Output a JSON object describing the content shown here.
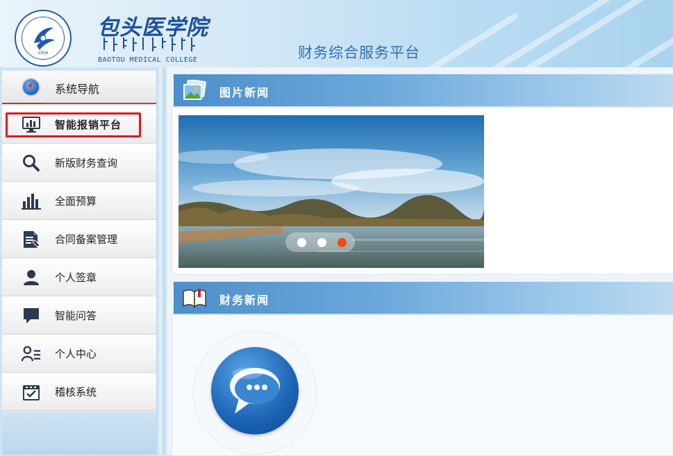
{
  "header": {
    "school_name": "包头医学院",
    "school_name_en": "BAOTOU MEDICAL COLLEGE",
    "logo_year": "1956",
    "platform_title": "财务综合服务平台"
  },
  "sidebar": {
    "title": "系统导航",
    "items": [
      {
        "label": "智能报销平台",
        "icon": "monitor-chart-icon",
        "highlighted": true
      },
      {
        "label": "新版财务查询",
        "icon": "search-icon"
      },
      {
        "label": "全面预算",
        "icon": "bar-chart-icon"
      },
      {
        "label": "合同备案管理",
        "icon": "document-icon"
      },
      {
        "label": "个人签章",
        "icon": "user-icon"
      },
      {
        "label": "智能问答",
        "icon": "chat-icon"
      },
      {
        "label": "个人中心",
        "icon": "user-list-icon"
      },
      {
        "label": "稽核系统",
        "icon": "calendar-check-icon"
      }
    ]
  },
  "photo_news": {
    "title": "图片新闻",
    "icon": "picture-icon",
    "slides_total": 3,
    "active_slide": 3
  },
  "finance_news": {
    "title": "财务新闻",
    "icon": "book-icon"
  },
  "colors": {
    "accent_blue": "#2f6fb5",
    "highlight_red": "#e4141e",
    "active_dot": "#f24a12"
  }
}
